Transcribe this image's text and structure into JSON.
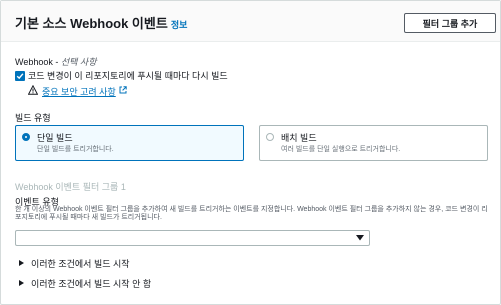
{
  "header": {
    "title": "기본 소스 Webhook 이벤트",
    "info": "정보",
    "add_filter_group": "필터 그룹 추가"
  },
  "webhook": {
    "label": "Webhook -",
    "optional": "선택 사항",
    "checkbox_label": "코드 변경이 이 리포지토리에 푸시될 때마다 다시 빌드",
    "checked": true,
    "security_link": "중요 보안 고려 사항"
  },
  "build_type": {
    "label": "빌드 유형",
    "options": [
      {
        "title": "단일 빌드",
        "desc": "단일 빌드를 트리거합니다.",
        "selected": true
      },
      {
        "title": "배치 빌드",
        "desc": "여러 빌드를 단일 실행으로 트리거합니다.",
        "selected": false
      }
    ]
  },
  "filter_group": {
    "title": "Webhook 이벤트 필터 그룹 1",
    "event_type_label": "이벤트 유형",
    "event_type_desc": "한 개 이상의 Webhook 이벤트 필터 그룹을 추가하여 새 빌드를 트리거하는 이벤트를 지정합니다. Webhook 이벤트 필터 그룹을 추가하지 않는 경우, 코드 변경이 리포지토리에 푸시될 때마다 새 빌드가 트리거됩니다.",
    "select_value": "",
    "start_conditions": "이러한 조건에서 빌드 시작",
    "no_start_conditions": "이러한 조건에서 빌드 시작 안 함"
  },
  "colors": {
    "accent": "#0073bb",
    "border": "#aab7b8",
    "text": "#16191f"
  }
}
